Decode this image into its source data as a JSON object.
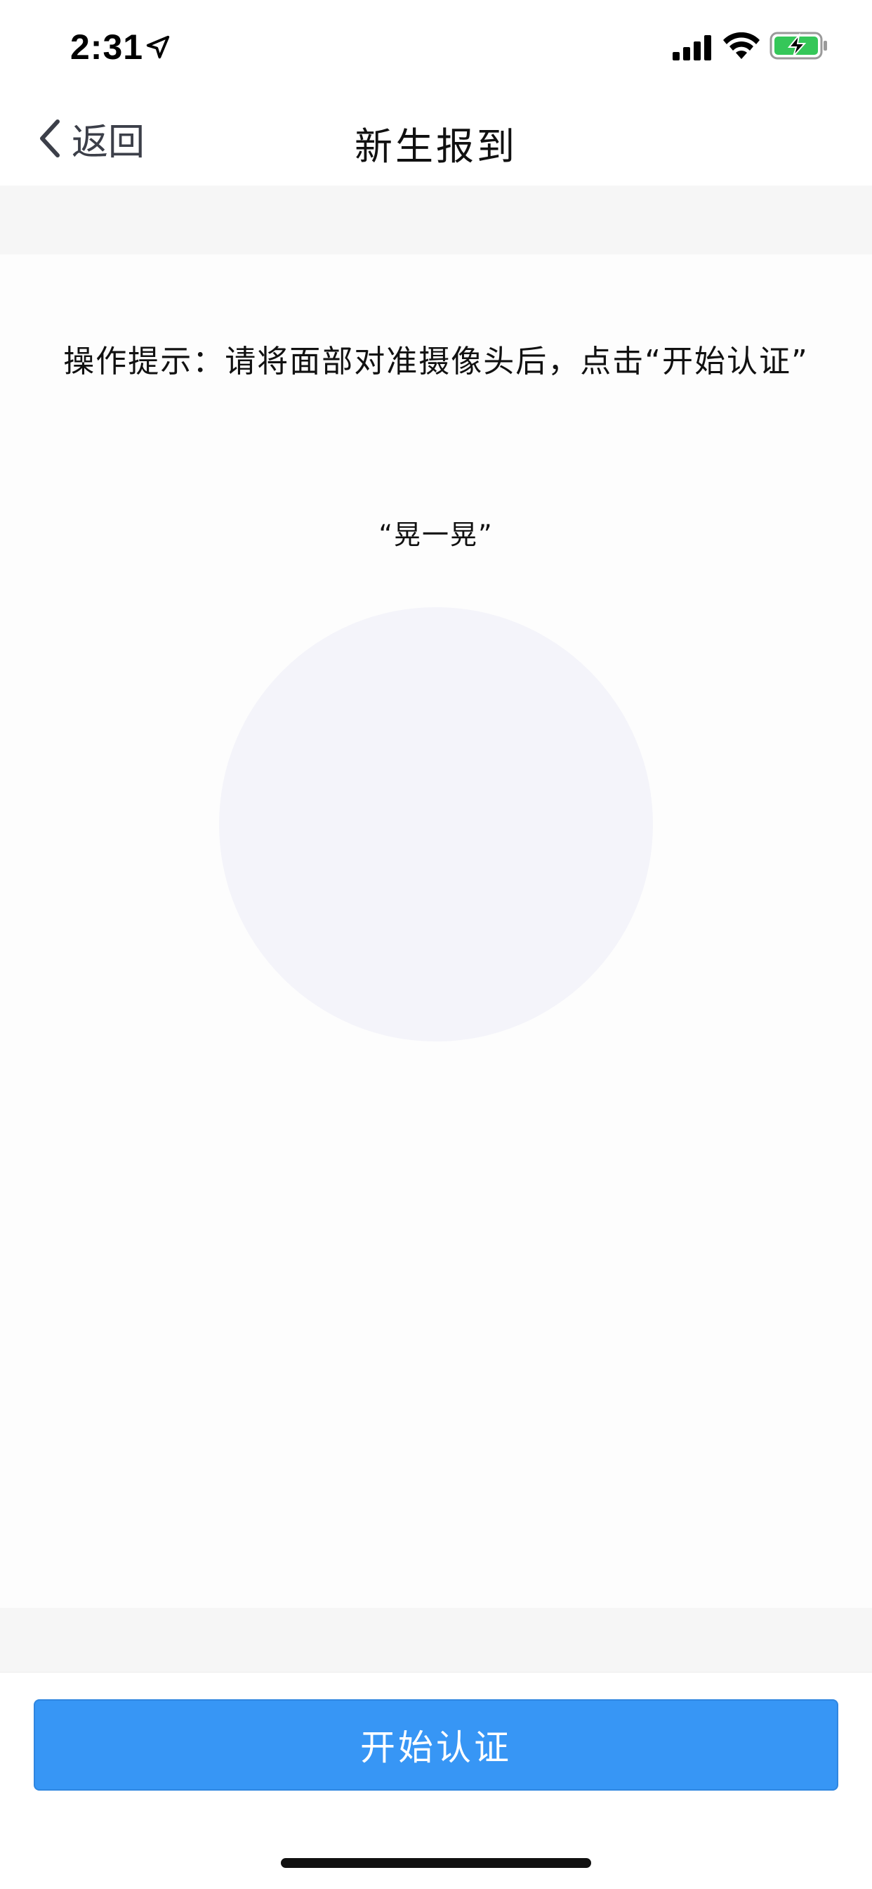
{
  "status_bar": {
    "time": "2:31",
    "location_icon": "location-arrow-icon",
    "signal_icon": "cellular-signal-icon",
    "wifi_icon": "wifi-icon",
    "battery_icon": "battery-charging-icon",
    "battery_color": "#35c759"
  },
  "nav": {
    "back_label": "返回",
    "title": "新生报到"
  },
  "main": {
    "hint": "操作提示：请将面部对准摄像头后，点击“开始认证”",
    "action": "“晃一晃”",
    "camera_preview_color": "#f4f4fa"
  },
  "footer": {
    "start_button_label": "开始认证",
    "accent_color": "#3796f5"
  }
}
